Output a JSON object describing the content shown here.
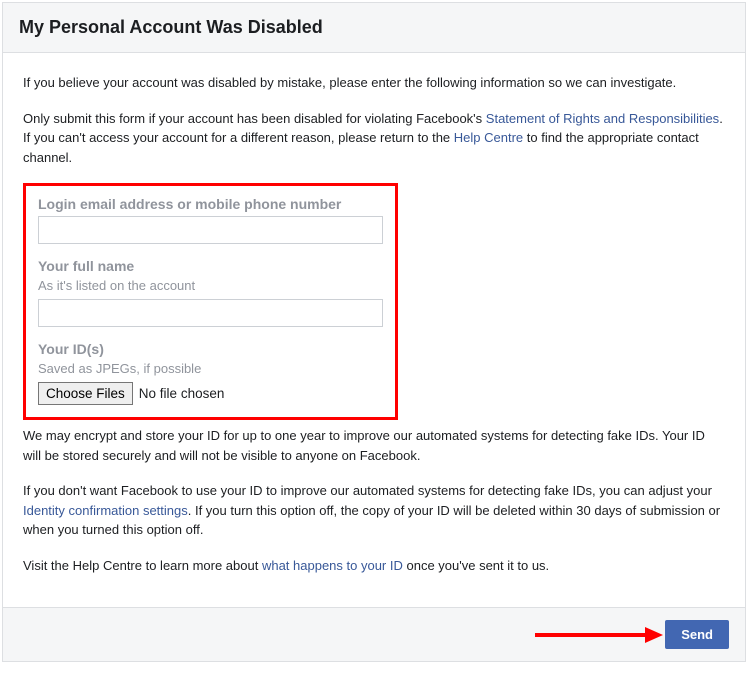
{
  "header": {
    "title": "My Personal Account Was Disabled"
  },
  "intro": {
    "p1": "If you believe your account was disabled by mistake, please enter the following information so we can investigate.",
    "p2_a": "Only submit this form if your account has been disabled for violating Facebook's ",
    "p2_link1": "Statement of Rights and Responsibilities",
    "p2_b": ". If you can't access your account for a different reason, please return to the ",
    "p2_link2": "Help Centre",
    "p2_c": " to find the appropriate contact channel."
  },
  "form": {
    "login_label": "Login email address or mobile phone number",
    "name_label": "Your full name",
    "name_hint": "As it's listed on the account",
    "id_label": "Your ID(s)",
    "id_hint": "Saved as JPEGs, if possible",
    "choose_files": "Choose Files",
    "no_file": "No file chosen"
  },
  "after": {
    "p1": "We may encrypt and store your ID for up to one year to improve our automated systems for detecting fake IDs. Your ID will be stored securely and will not be visible to anyone on Facebook.",
    "p2_a": "If you don't want Facebook to use your ID to improve our automated systems for detecting fake IDs, you can adjust your ",
    "p2_link": "Identity confirmation settings",
    "p2_b": ". If you turn this option off, the copy of your ID will be deleted within 30 days of submission or when you turned this option off.",
    "p3_a": "Visit the Help Centre to learn more about ",
    "p3_link": "what happens to your ID",
    "p3_b": " once you've sent it to us."
  },
  "footer": {
    "send": "Send"
  }
}
